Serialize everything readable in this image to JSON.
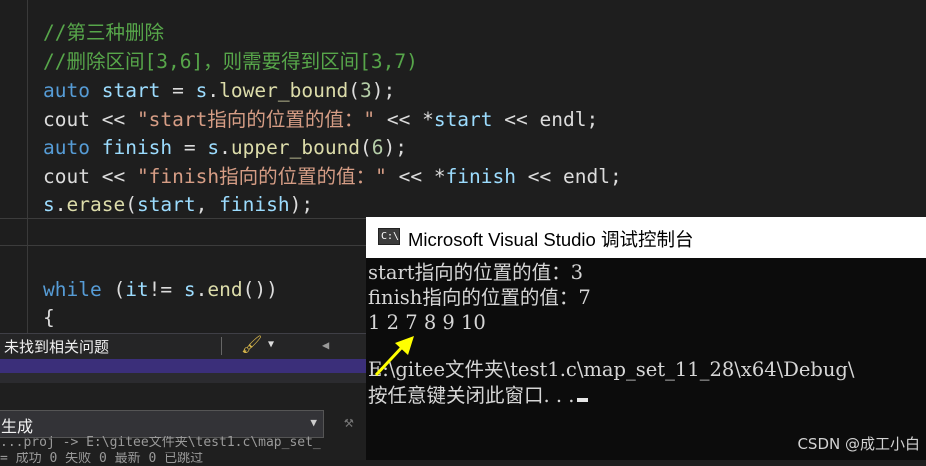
{
  "editor": {
    "lines": {
      "l1": "//第三种删除",
      "l2": "//删除区间[3,6]，则需要得到区间[3,7)",
      "l3_kw": "auto",
      "l3_var": "start",
      "l3_op": " = ",
      "l3_obj": "s",
      "l3_fn": "lower_bound",
      "l3_num": "3",
      "l4_a": "cout",
      "l4_b": " << ",
      "l4_str": "\"start指向的位置的值：\"",
      "l4_c": " << *",
      "l4_var": "start",
      "l4_d": " << ",
      "l4_e": "endl",
      "l4_f": ";",
      "l5_kw": "auto",
      "l5_var": "finish",
      "l5_op": " = ",
      "l5_obj": "s",
      "l5_fn": "upper_bound",
      "l5_num": "6",
      "l6_a": "cout",
      "l6_b": " << ",
      "l6_str": "\"finish指向的位置的值：\"",
      "l6_c": " << *",
      "l6_var": "finish",
      "l6_d": " << ",
      "l6_e": "endl",
      "l6_f": ";",
      "l7_obj": "s",
      "l7_fn": "erase",
      "l7_a1": "start",
      "l7_a2": "finish",
      "l8_kw": "while",
      "l8_obj": "s",
      "l8_fn": "end",
      "l9": "{"
    }
  },
  "status_bar": {
    "issues_text": "未找到相关问题"
  },
  "output_panel": {
    "combo_value": "生成",
    "line1": "...proj -> E:\\gitee文件夹\\test1.c\\map_set_",
    "line2": "= 成功 0 失败 0 最新 0 已跳过"
  },
  "console": {
    "title": "Microsoft Visual Studio 调试控制台",
    "icon_text": "C:\\",
    "lines": [
      "start指向的位置的值：3",
      "finish指向的位置的值：7",
      "1 2 7 8 9 10",
      "",
      "E:\\gitee文件夹\\test1.c\\map_set_11_28\\x64\\Debug\\",
      "按任意键关闭此窗口. . ."
    ]
  },
  "watermark": "CSDN @成工小白",
  "colors": {
    "comment": "#57a64a",
    "keyword": "#569cd6",
    "variable": "#9cdcfe",
    "function": "#dcdcaa",
    "string": "#d69d85",
    "number": "#b5cea8",
    "annotation_arrow": "#ffff00"
  }
}
